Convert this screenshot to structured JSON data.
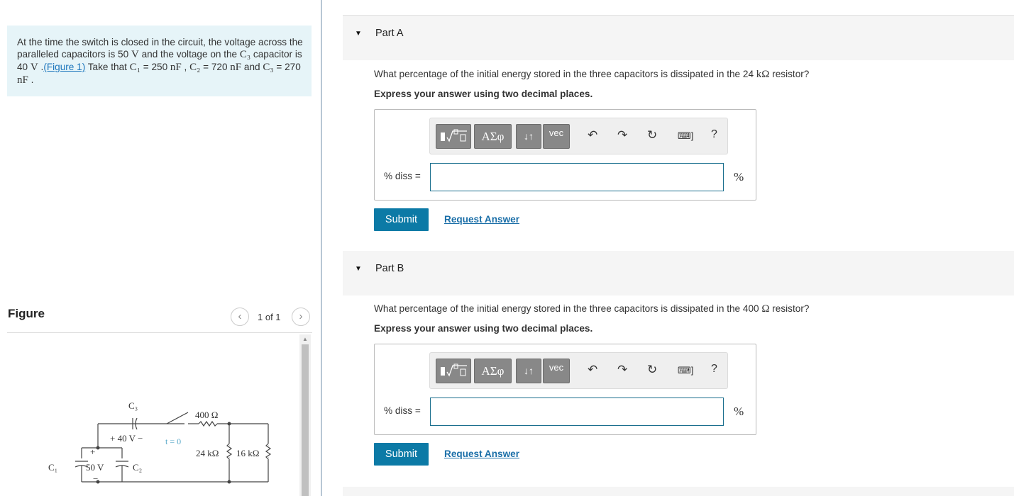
{
  "problem": {
    "segments": [
      {
        "t": "At the time the switch is closed in the circuit, the voltage across the paralleled capacitors is 50 ",
        "math": false
      },
      {
        "t": "V",
        "math": true
      },
      {
        "t": " and the voltage on the ",
        "math": false
      },
      {
        "t": "C₃",
        "math": true
      },
      {
        "t": " capacitor is 40 ",
        "math": false
      },
      {
        "t": "V",
        "math": true
      },
      {
        "t": " .",
        "math": false
      }
    ],
    "figure_link": "(Figure 1)",
    "segments2": [
      {
        "t": " Take that ",
        "math": false
      },
      {
        "t": "C₁",
        "math": true
      },
      {
        "t": " = 250 ",
        "math": false
      },
      {
        "t": "nF",
        "math": true
      },
      {
        "t": " , ",
        "math": false
      },
      {
        "t": "C₂",
        "math": true
      },
      {
        "t": " = 720 ",
        "math": false
      },
      {
        "t": "nF",
        "math": true
      },
      {
        "t": " and ",
        "math": false
      },
      {
        "t": "C₃",
        "math": true
      },
      {
        "t": " = 270 ",
        "math": false
      },
      {
        "t": "nF",
        "math": true
      },
      {
        "t": " .",
        "math": false
      }
    ]
  },
  "figure": {
    "title": "Figure",
    "counter": "1 of 1",
    "prev_icon": "chevron-left-icon",
    "next_icon": "chevron-right-icon",
    "circuit_labels": {
      "c3": "C₃",
      "v40": "+ 40 V −",
      "t0": "t = 0",
      "r400": "400 Ω",
      "r24k": "24 kΩ",
      "r16k": "16 kΩ",
      "c1": "C₁",
      "v50": "50 V",
      "c2": "C₂",
      "plus": "+",
      "minus": "−"
    }
  },
  "parts": [
    {
      "label": "Part A",
      "question_pre": "What percentage of the initial energy stored in the three capacitors is dissipated in the 24 ",
      "question_math": "kΩ",
      "question_post": " resistor?",
      "instruction": "Express your answer using two decimal places.",
      "answer_label": "% diss =",
      "answer_value": "",
      "unit": "%",
      "submit": "Submit",
      "request": "Request Answer"
    },
    {
      "label": "Part B",
      "question_pre": "What percentage of the initial energy stored in the three capacitors is dissipated in the 400 ",
      "question_math": "Ω",
      "question_post": " resistor?",
      "instruction": "Express your answer using two decimal places.",
      "answer_label": "% diss =",
      "answer_value": "",
      "unit": "%",
      "submit": "Submit",
      "request": "Request Answer"
    }
  ],
  "toolbar": {
    "template_icon": "fraction-sqrt-template-icon",
    "greek": "ΑΣφ",
    "arrows": "↓↑",
    "vec": "vec",
    "undo_icon": "undo-icon",
    "redo_icon": "redo-icon",
    "reset_icon": "reset-icon",
    "keyboard_icon": "keyboard-icon",
    "help": "?"
  }
}
